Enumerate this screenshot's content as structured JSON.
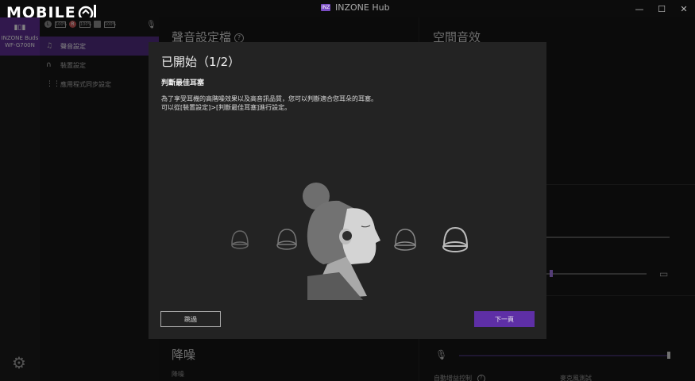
{
  "titlebar": {
    "logo_text": "MOBILE",
    "logo_suffix": "01",
    "app_title": "INZONE Hub",
    "badge": "INZ",
    "minimize": "—",
    "maximize": "☐",
    "close": "✕"
  },
  "device": {
    "name_line1": "INZONE Buds",
    "name_line2": "WF-G700N",
    "icon": "earbuds-icon"
  },
  "status": {
    "left_label": "L",
    "right_label": "R",
    "battery_left": "100%",
    "battery_right": "100%",
    "battery_case": "100%"
  },
  "sidebar": {
    "items": [
      {
        "label": "聲音設定",
        "icon": "music-note-icon"
      },
      {
        "label": "裝置設定",
        "icon": "headphone-icon"
      },
      {
        "label": "應用程式同步設定",
        "icon": "grid-icon"
      }
    ]
  },
  "main": {
    "sound_settings_title": "聲音設定檔",
    "spatial_title": "空間音效",
    "anc_title": "降噪",
    "anc_sub": "降噪",
    "auto_gain_label": "自動增益控制",
    "mic_test_label": "麥克風測試"
  },
  "modal": {
    "title": "已開始（1/2）",
    "subtitle": "判斷最佳耳塞",
    "desc_line1": "為了享受耳機的高階噪效果以及高音訊品質，您可以判斷適合您耳朵的耳塞。",
    "desc_line2": "可以從[裝置設定]>[判斷最佳耳塞]進行設定。",
    "skip_label": "跳過",
    "next_label": "下一頁"
  },
  "colors": {
    "accent": "#5e2fa6",
    "sidebar_active": "#4e2a7a",
    "device_card": "#5a2c8c"
  }
}
